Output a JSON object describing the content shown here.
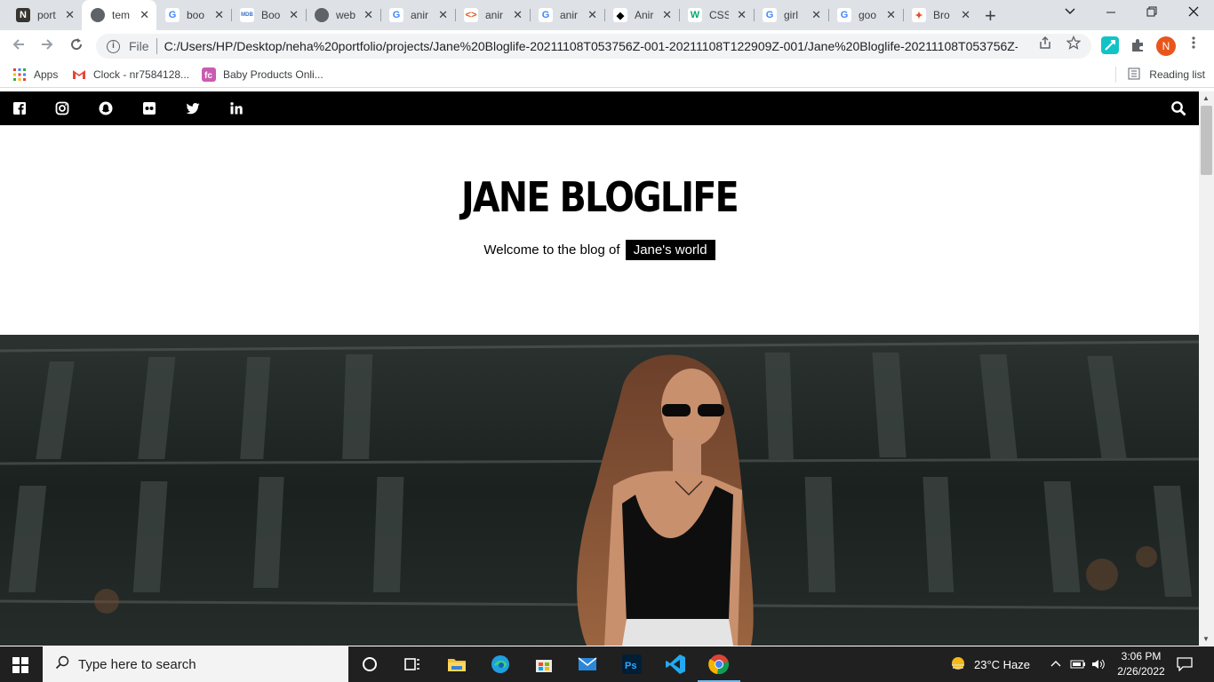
{
  "browser": {
    "tabs": [
      {
        "label": "port",
        "icon": "notion-icon",
        "active": false
      },
      {
        "label": "tem",
        "icon": "globe-icon",
        "active": true
      },
      {
        "label": "boo",
        "icon": "google-icon",
        "active": false
      },
      {
        "label": "Boo",
        "icon": "mdb-icon",
        "active": false
      },
      {
        "label": "web",
        "icon": "globe-icon",
        "active": false
      },
      {
        "label": "anir",
        "icon": "google-icon",
        "active": false
      },
      {
        "label": "anir",
        "icon": "code-icon",
        "active": false
      },
      {
        "label": "anir",
        "icon": "google-icon",
        "active": false
      },
      {
        "label": "Anir",
        "icon": "diamond-icon",
        "active": false
      },
      {
        "label": "CSS",
        "icon": "w3schools-icon",
        "active": false
      },
      {
        "label": "girl",
        "icon": "google-icon",
        "active": false
      },
      {
        "label": "goo",
        "icon": "google-icon",
        "active": false
      },
      {
        "label": "Bro",
        "icon": "puzzle-icon",
        "active": false
      }
    ],
    "address": {
      "scheme_label": "File",
      "url": "C:/Users/HP/Desktop/neha%20portfolio/projects/Jane%20Bloglife-20211108T053756Z-001-20211108T122909Z-001/Jane%20Bloglife-20211108T053756Z-0..."
    },
    "profile_initial": "N",
    "bookmarks": [
      {
        "label": "Apps",
        "icon": "apps-grid-icon"
      },
      {
        "label": "Clock - nr7584128...",
        "icon": "gmail-icon"
      },
      {
        "label": "Baby Products Onli...",
        "icon": "firstcry-icon"
      }
    ],
    "reading_list": "Reading list"
  },
  "page": {
    "social_icons": [
      "facebook-icon",
      "instagram-icon",
      "snapchat-icon",
      "flickr-icon",
      "twitter-icon",
      "linkedin-icon"
    ],
    "brand_title": "JANE BLOGLIFE",
    "tagline_prefix": "Welcome to the blog of",
    "tagline_highlight": "Jane's world"
  },
  "taskbar": {
    "search_placeholder": "Type here to search",
    "weather": "23°C  Haze",
    "time": "3:06 PM",
    "date": "2/26/2022"
  },
  "colors": {
    "topbar": "#000000",
    "chrome_tabstrip": "#dee1e6",
    "taskbar": "#202020",
    "profile_avatar": "#e8561c"
  }
}
